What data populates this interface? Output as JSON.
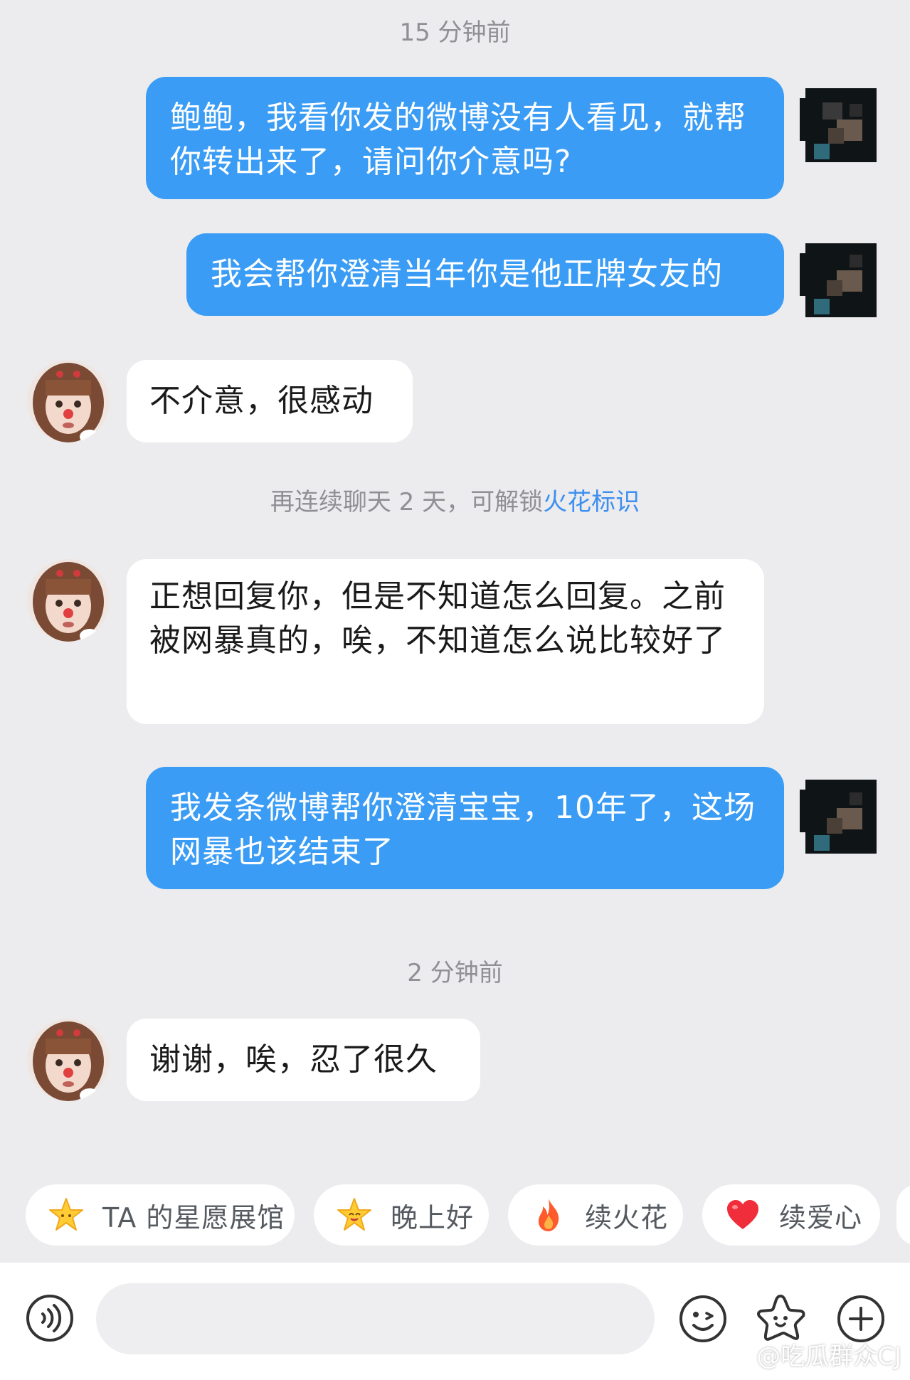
{
  "timestamps": {
    "first": "15 分钟前",
    "second": "2 分钟前"
  },
  "messages": [
    {
      "side": "out",
      "text": "鲍鲍，我看你发的微博没有人看见，就帮你转出来了，请问你介意吗?"
    },
    {
      "side": "out",
      "text": "我会帮你澄清当年你是他正牌女友的"
    },
    {
      "side": "in",
      "text": "不介意，很感动"
    },
    {
      "side": "in",
      "text": "正想回复你，但是不知道怎么回复。之前被网暴真的，唉，不知道怎么说比较好了"
    },
    {
      "side": "out",
      "text": "我发条微博帮你澄清宝宝，10年了，这场网暴也该结束了"
    },
    {
      "side": "in",
      "text": "谢谢，唉，忍了很久"
    }
  ],
  "system_note": {
    "prefix": "再连续聊天 2 天，可解锁",
    "link": "火花标识"
  },
  "quick_replies": [
    {
      "label": "TA 的星愿展馆",
      "icon": "star-icon"
    },
    {
      "label": "晚上好",
      "icon": "smiling-star-icon"
    },
    {
      "label": "续火花",
      "icon": "flame-icon"
    },
    {
      "label": "续爱心",
      "icon": "heart-icon"
    }
  ],
  "bottom_bar": {
    "icons": [
      "voice-icon",
      "emoji-icon",
      "sticker-star-icon",
      "plus-icon"
    ]
  },
  "watermark": "@吃瓜群众CJ",
  "colors": {
    "background": "#ececee",
    "outgoing_bubble": "#3a9cf4",
    "incoming_bubble": "#ffffff",
    "link": "#3d8ff0",
    "timestamp": "#8f8f95"
  }
}
